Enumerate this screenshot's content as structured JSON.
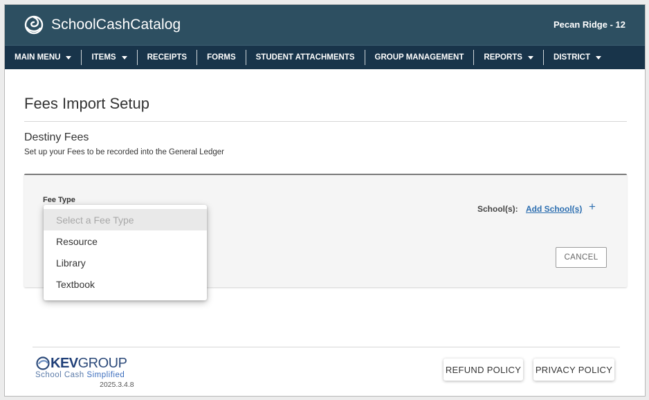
{
  "header": {
    "app_title": "SchoolCashCatalog",
    "school_name": "Pecan Ridge - 12",
    "logo_icon": "spiral-logo-icon"
  },
  "nav": {
    "items": [
      {
        "label": "MAIN MENU",
        "has_dropdown": true
      },
      {
        "label": "ITEMS",
        "has_dropdown": true
      },
      {
        "label": "RECEIPTS",
        "has_dropdown": false
      },
      {
        "label": "FORMS",
        "has_dropdown": false
      },
      {
        "label": "STUDENT ATTACHMENTS",
        "has_dropdown": false
      },
      {
        "label": "GROUP MANAGEMENT",
        "has_dropdown": false
      },
      {
        "label": "REPORTS",
        "has_dropdown": true
      },
      {
        "label": "DISTRICT",
        "has_dropdown": true
      }
    ]
  },
  "page": {
    "title": "Fees Import Setup",
    "section_title": "Destiny Fees",
    "section_subtitle": "Set up your Fees to be recorded into the General Ledger"
  },
  "form": {
    "fee_type_label": "Fee Type",
    "schools_label": "School(s):",
    "add_school_link": "Add School(s)",
    "add_icon": "plus-icon",
    "cancel_label": "CANCEL"
  },
  "dropdown": {
    "placeholder": "Select a Fee Type",
    "options": [
      "Resource",
      "Library",
      "Textbook"
    ]
  },
  "footer": {
    "brand_kev": "KEV",
    "brand_group": "GROUP",
    "tagline_main": "School Cash ",
    "tagline_accent": "Simplified",
    "version": "2025.3.4.8",
    "refund_label": "REFUND POLICY",
    "privacy_label": "PRIVACY POLICY"
  },
  "colors": {
    "header_bg": "#2d4f61",
    "nav_bg": "#18344a",
    "link": "#2c6eb0"
  }
}
